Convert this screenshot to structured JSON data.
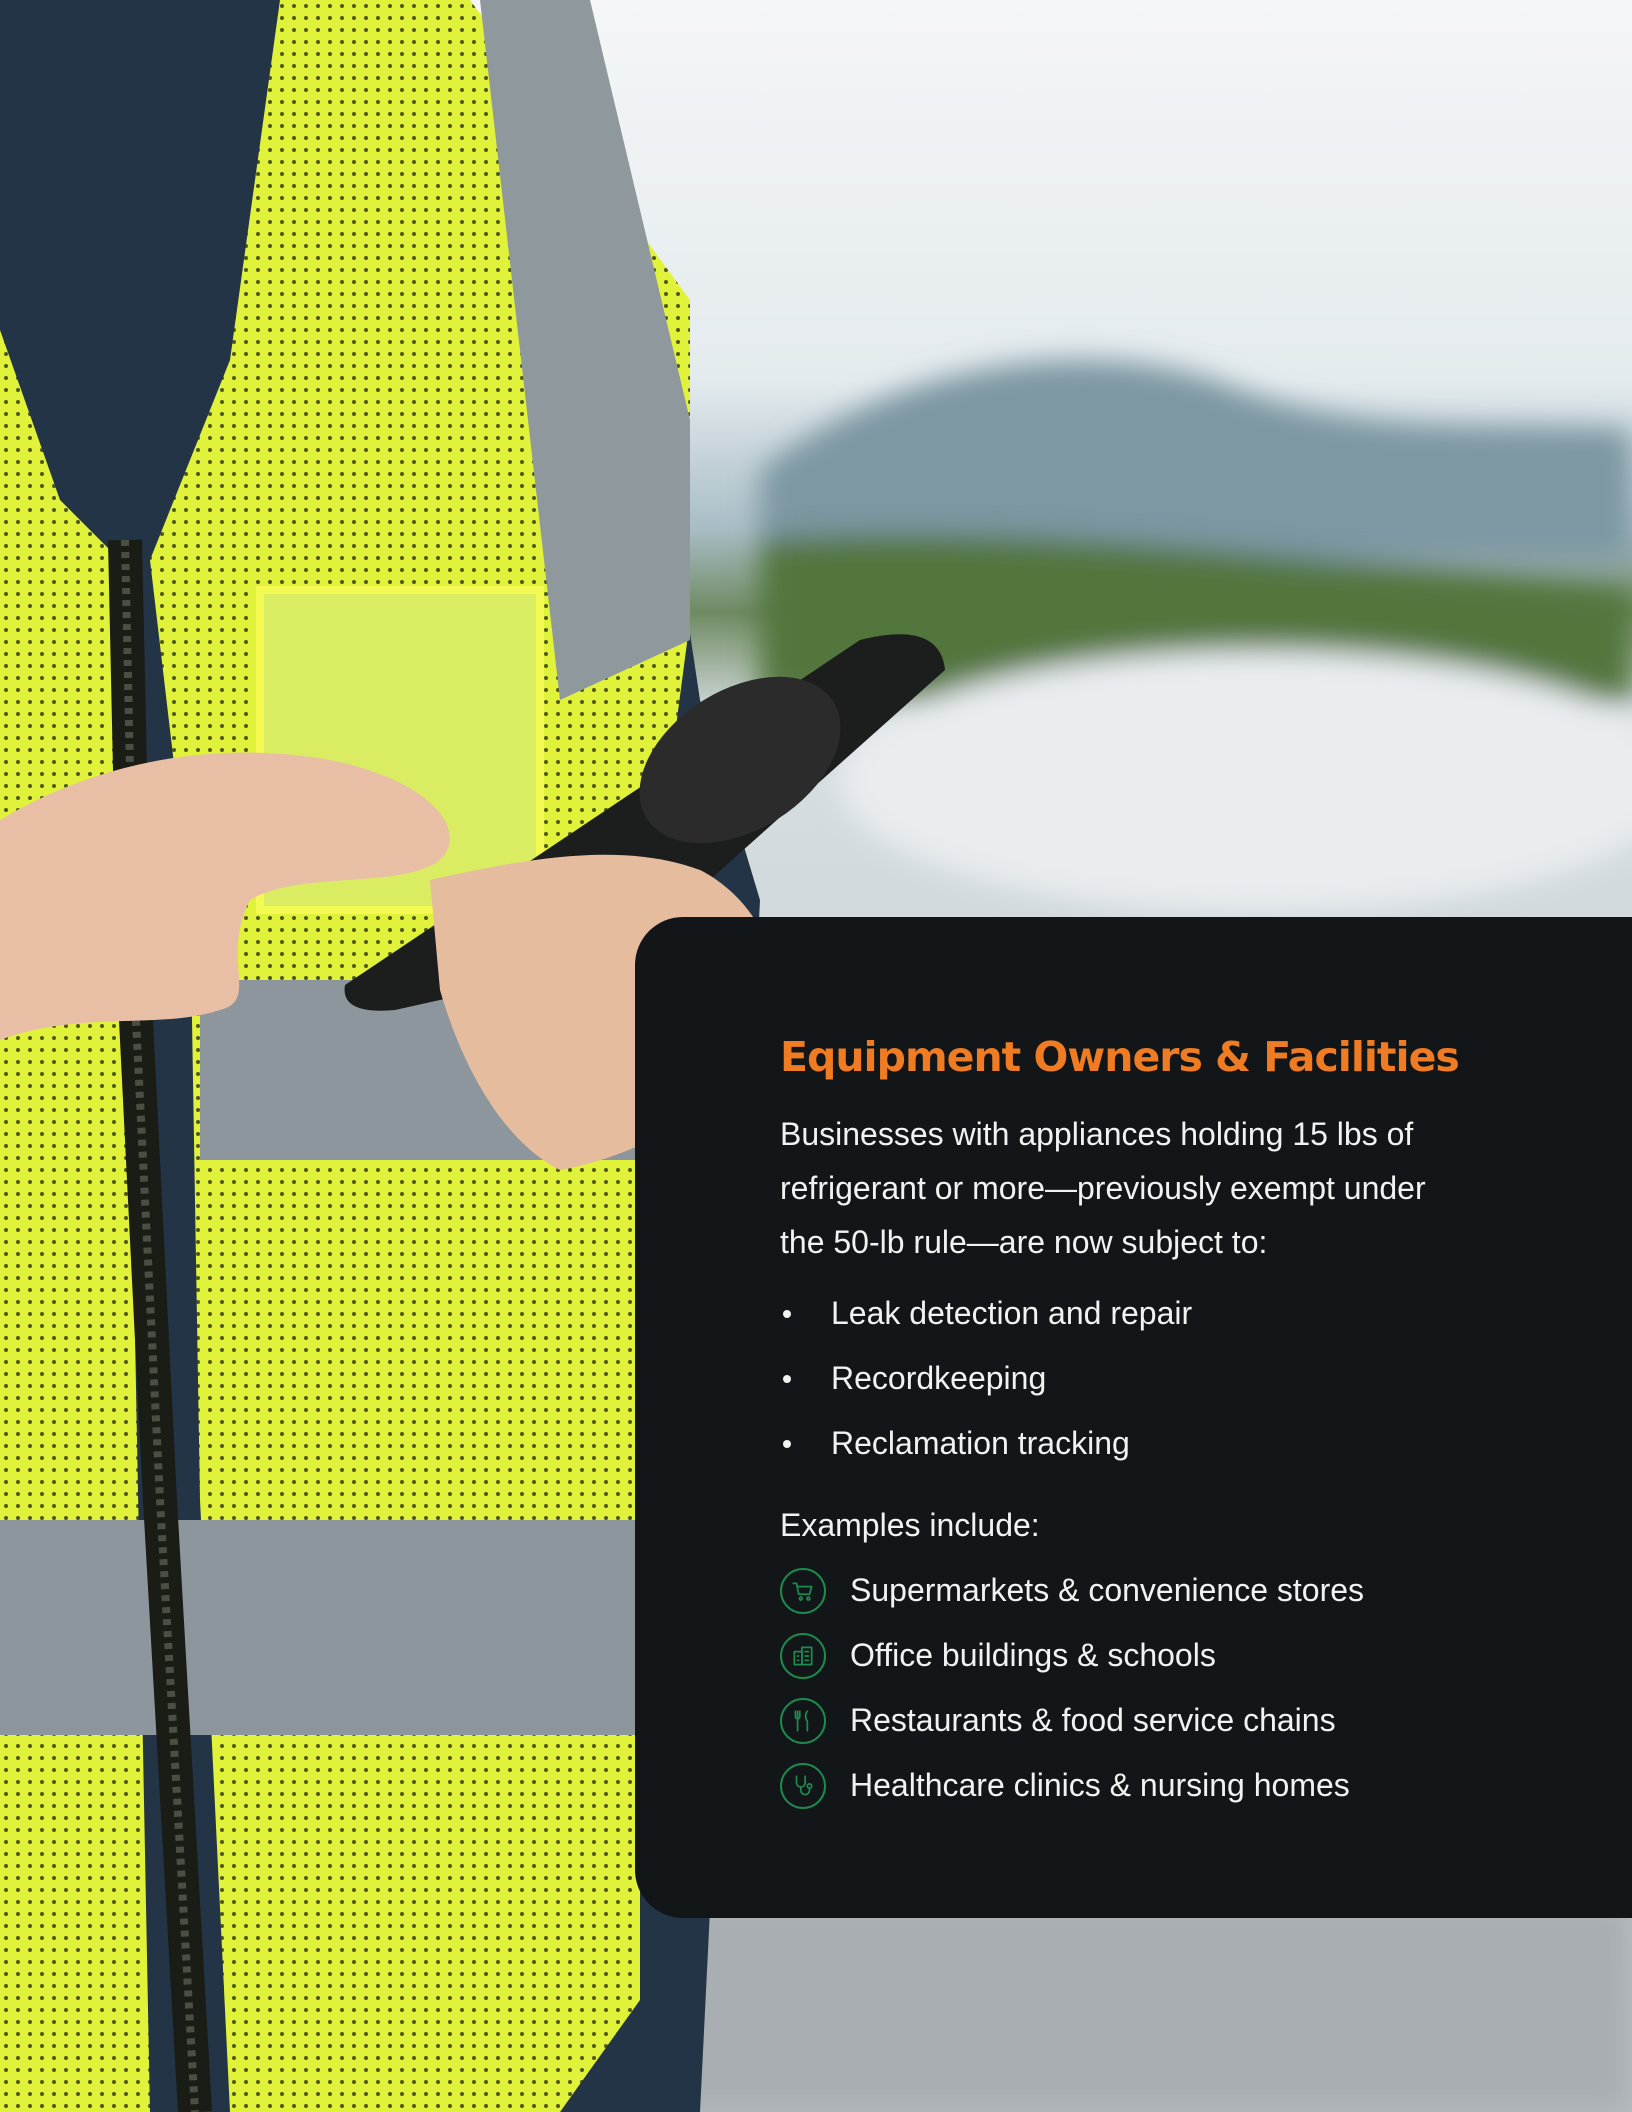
{
  "photo": {
    "description_icon": "worker-in-safety-vest-using-phone-photo"
  },
  "card": {
    "title": "Equipment Owners & Facilities",
    "intro": "Businesses with appliances holding 15 lbs of refrigerant or more—previously exempt under the 50-lb rule—are now subject to:",
    "bullets": [
      "Leak detection and repair",
      "Recordkeeping",
      "Reclamation tracking"
    ],
    "examples_label": "Examples include:",
    "examples": [
      {
        "icon": "shopping-cart-icon",
        "text": "Supermarkets & convenience stores"
      },
      {
        "icon": "office-building-icon",
        "text": "Office buildings & schools"
      },
      {
        "icon": "fork-knife-icon",
        "text": "Restaurants & food service chains"
      },
      {
        "icon": "stethoscope-icon",
        "text": "Healthcare clinics & nursing homes"
      }
    ]
  },
  "colors": {
    "title": "#ef7c22",
    "card_background": "#121619",
    "icon_ring": "#1d8a4e"
  }
}
